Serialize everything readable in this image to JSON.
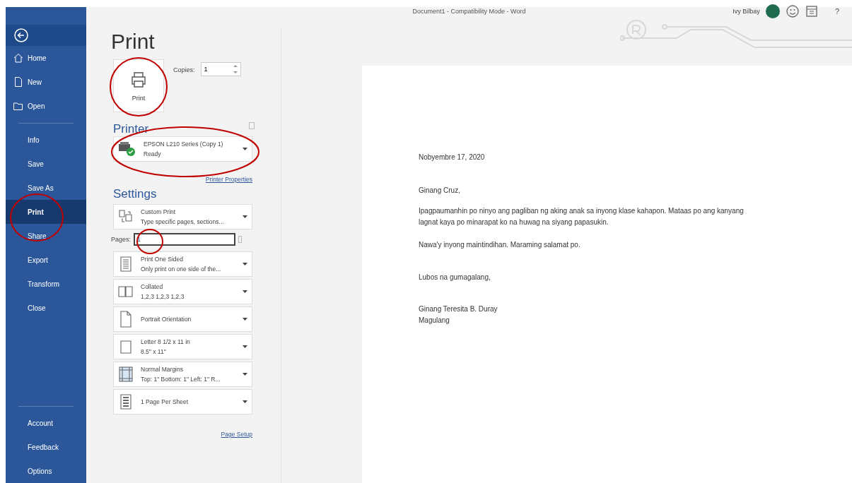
{
  "title_bar": {
    "title": "Document1  -  Compatibility Mode  -  Word",
    "user_name": "Ivy Bilbay",
    "help": "?"
  },
  "sidebar": {
    "top_items": [
      {
        "label": "Home",
        "selected": false
      },
      {
        "label": "New",
        "selected": false
      },
      {
        "label": "Open",
        "selected": false
      }
    ],
    "middle_items": [
      {
        "label": "Info",
        "selected": false
      },
      {
        "label": "Save",
        "selected": false
      },
      {
        "label": "Save As",
        "selected": false
      },
      {
        "label": "Print",
        "selected": true
      },
      {
        "label": "Share",
        "selected": false
      },
      {
        "label": "Export",
        "selected": false
      },
      {
        "label": "Transform",
        "selected": false
      },
      {
        "label": "Close",
        "selected": false
      }
    ],
    "bottom_items": [
      {
        "label": "Account",
        "selected": false
      },
      {
        "label": "Feedback",
        "selected": false
      },
      {
        "label": "Options",
        "selected": false
      }
    ]
  },
  "print_panel": {
    "heading": "Print",
    "print_button": "Print",
    "copies_label": "Copies:",
    "copies_value": "1",
    "printer_heading": "Printer",
    "printer": {
      "name": "EPSON L210 Series (Copy 1)",
      "status": "Ready"
    },
    "printer_properties": "Printer Properties",
    "settings_heading": "Settings",
    "settings": [
      {
        "kind": "pages",
        "title": "Custom Print",
        "subtitle": "Type specific pages, sections..."
      },
      {
        "kind": "pages-field",
        "label": "Pages:",
        "value": "1"
      },
      {
        "kind": "sides",
        "title": "Print One Sided",
        "subtitle": "Only print on one side of the..."
      },
      {
        "kind": "collate",
        "title": "Collated",
        "subtitle": "1,2,3    1,2,3    1,2,3"
      },
      {
        "kind": "orientation",
        "title": "Portrait Orientation"
      },
      {
        "kind": "paper",
        "title": "Letter 8 1/2 x 11 in",
        "subtitle": "8.5\" x 11\""
      },
      {
        "kind": "margins",
        "title": "Normal Margins",
        "subtitle": "Top: 1\" Bottom: 1\" Left: 1\" R..."
      },
      {
        "kind": "per-sheet",
        "title": "1 Page Per Sheet"
      }
    ],
    "page_setup": "Page Setup"
  },
  "preview": {
    "letter": [
      {
        "lines": [
          "Nobyembre 17, 2020"
        ]
      },
      {
        "lines": [
          "Ginang Cruz,"
        ]
      },
      {
        "lines": [
          "Ipagpaumanhin po ninyo ang pagliban ng aking anak sa inyong klase kahapon. Mataas po ang kanyang",
          "lagnat kaya po minarapat ko na huwag na siyang papasukin."
        ]
      },
      {
        "lines": [
          "Nawa'y inyong maintindihan. Maraming salamat po."
        ]
      },
      {
        "lines": [
          "Lubos na gumagalang,"
        ]
      },
      {
        "lines": [
          "Ginang Teresita B. Duray",
          "Magulang"
        ]
      }
    ]
  }
}
